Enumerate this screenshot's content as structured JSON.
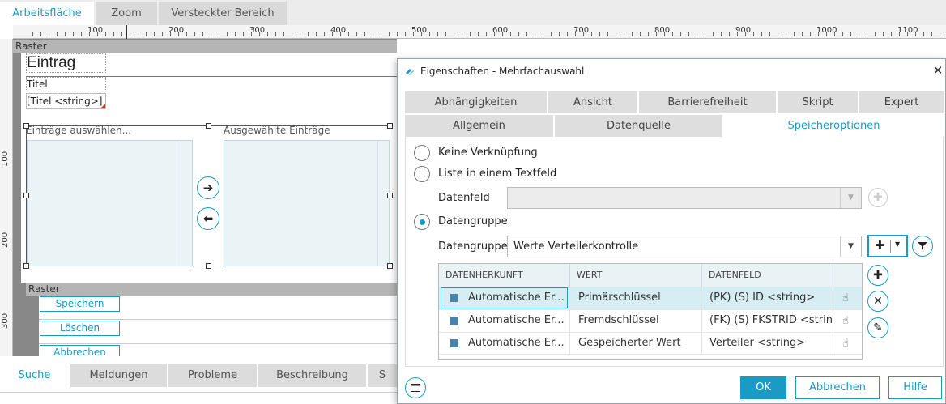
{
  "top_tabs": [
    "Arbeitsfläche",
    "Zoom",
    "Versteckter Bereich"
  ],
  "ruler": {
    "h_labels": [
      "100",
      "200",
      "300",
      "400",
      "500",
      "600",
      "700",
      "800",
      "900",
      "1000",
      "1100"
    ],
    "v_labels": [
      "100",
      "200",
      "300"
    ]
  },
  "canvas": {
    "raster_label": "Raster",
    "title_text": "Eintrag",
    "label_titel": "Titel",
    "field_titel": "[Titel <string>]",
    "left_list_label": "Einträge auswählen...",
    "right_list_label": "Ausgewählte Einträge",
    "arrow_right": "➔",
    "arrow_left": "⬅",
    "raster2_label": "Raster",
    "buttons": [
      "Speichern",
      "Löschen",
      "Abbrechen"
    ]
  },
  "bottom_tabs": [
    "Suche",
    "Meldungen",
    "Probleme",
    "Beschreibung",
    "S"
  ],
  "dialog": {
    "title": "Eigenschaften - Mehrfachauswahl",
    "close": "✕",
    "tabs_row1": [
      "Abhängigkeiten",
      "Ansicht",
      "Barrierefreiheit",
      "Skript",
      "Expert"
    ],
    "tabs_row2": [
      "Allgemein",
      "Datenquelle",
      "Speicheroptionen"
    ],
    "options": {
      "keine": "Keine Verknüpfung",
      "liste": "Liste in einem Textfeld",
      "datenfeld_label": "Datenfeld",
      "datenfeld_value": "",
      "datengruppe_radio": "Datengruppe",
      "datengruppe_label": "Datengruppe",
      "datengruppe_value": "Werte Verteilerkontrolle"
    },
    "grid": {
      "headers": [
        "DATENHERKUNFT",
        "WERT",
        "DATENFELD"
      ],
      "rows": [
        [
          "Automatische Er...",
          "Primärschlüssel",
          "(PK) (S) ID <string>"
        ],
        [
          "Automatische Er...",
          "Fremdschlüssel",
          "(FK) (S) FKSTRID <strin..."
        ],
        [
          "Automatische Er...",
          "Gespeicherter Wert",
          "Verteiler <string>"
        ]
      ],
      "selected_row": 0
    },
    "footer": {
      "ok": "OK",
      "cancel": "Abbrechen",
      "help": "Hilfe"
    },
    "accent": "#1a9bc4"
  }
}
